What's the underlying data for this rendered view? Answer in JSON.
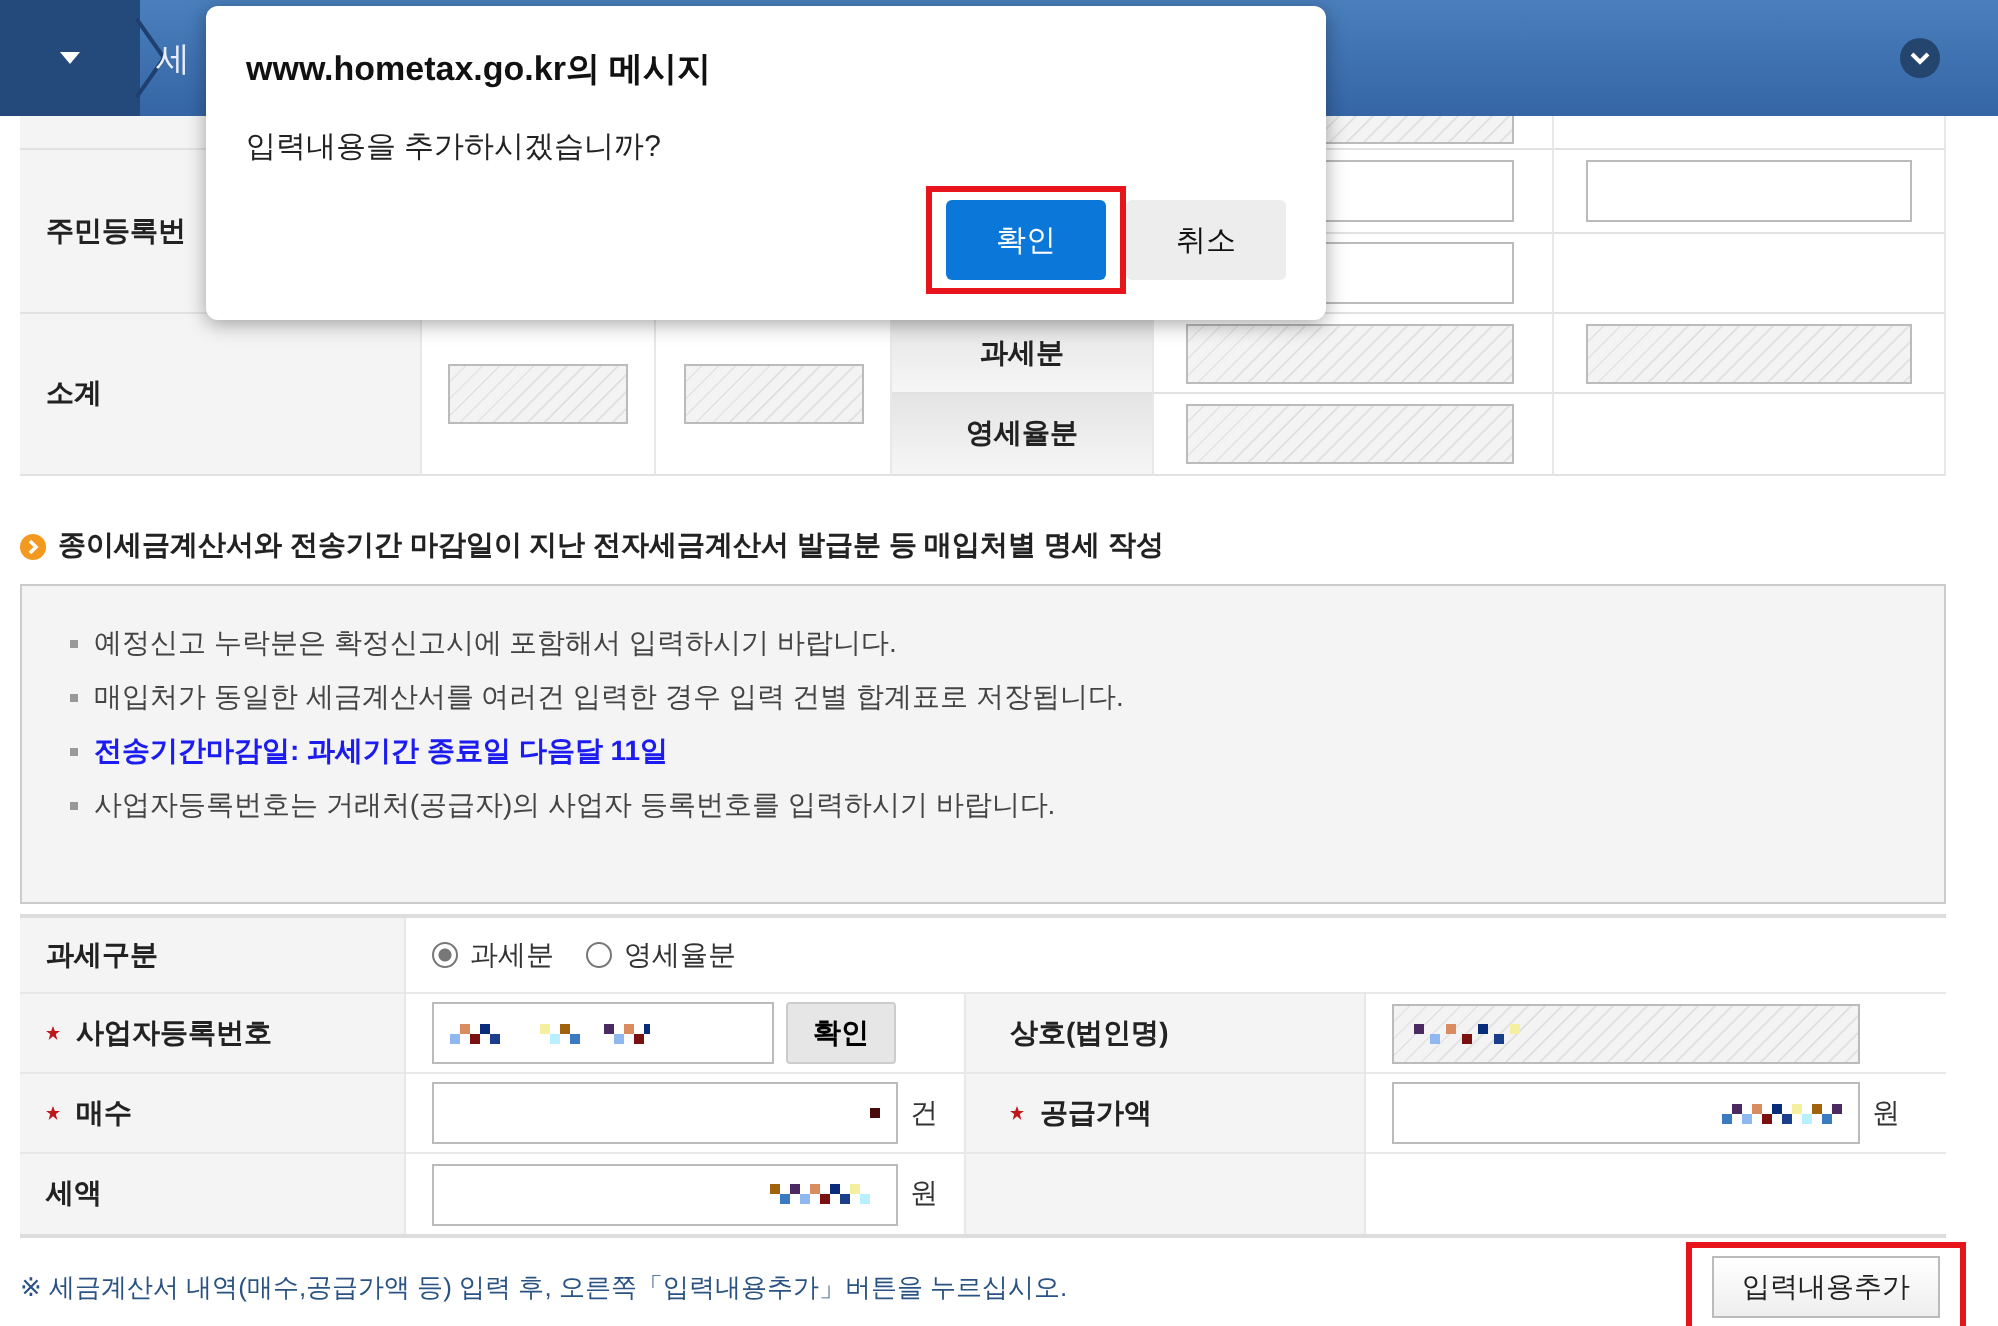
{
  "header": {
    "breadcrumb": "세"
  },
  "top_table": {
    "resident_label": "주민등록번",
    "subtotal_label": "소계",
    "sub_labels": [
      "과세분",
      "영세율분"
    ]
  },
  "section_title": "종이세금계산서와 전송기간 마감일이 지난 전자세금계산서 발급분 등 매입처별 명세 작성",
  "notices": [
    {
      "text": "예정신고 누락분은 확정신고시에 포함해서 입력하시기 바랍니다.",
      "highlight": false
    },
    {
      "text": "매입처가 동일한 세금계산서를 여러건 입력한 경우 입력 건별 합계표로 저장됩니다.",
      "highlight": false
    },
    {
      "text": "전송기간마감일: 과세기간 종료일 다음달 11일",
      "highlight": true
    },
    {
      "text": "사업자등록번호는 거래처(공급자)의 사업자 등록번호를 입력하시기 바랍니다.",
      "highlight": false
    }
  ],
  "form": {
    "tax_type": {
      "label": "과세구분",
      "options": [
        {
          "label": "과세분",
          "selected": true
        },
        {
          "label": "영세율분",
          "selected": false
        }
      ]
    },
    "business_number": {
      "label": "사업자등록번호",
      "required": true,
      "button": "확인"
    },
    "trade_name": {
      "label": "상호(법인명)"
    },
    "count": {
      "label": "매수",
      "required": true,
      "unit": "건"
    },
    "supply_amount": {
      "label": "공급가액",
      "required": true,
      "unit": "원"
    },
    "tax": {
      "label": "세액",
      "required": false,
      "unit": "원"
    }
  },
  "footer_note": "※ 세금계산서 내역(매수,공급가액 등) 입력 후, 오른쪽「입력내용추가」버튼을 누르십시오.",
  "add_button": "입력내용추가",
  "dialog": {
    "title": "www.hometax.go.kr의 메시지",
    "message": "입력내용을 추가하시겠습니까?",
    "buttons": [
      {
        "label": "확인",
        "kind": "primary"
      },
      {
        "label": "취소",
        "kind": "secondary"
      }
    ]
  }
}
